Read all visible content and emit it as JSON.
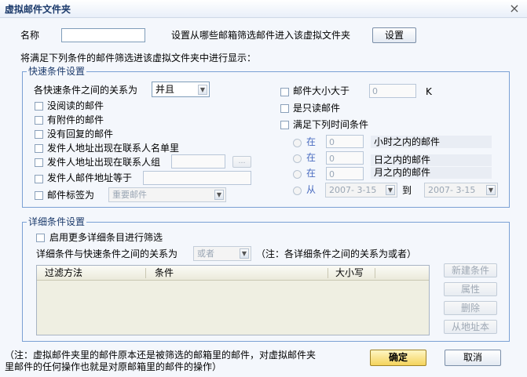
{
  "window": {
    "title": "虚拟邮件文件夹",
    "close_glyph": "×"
  },
  "name_row": {
    "label": "名称",
    "value": "",
    "hint": "设置从哪些邮箱筛选邮件进入该虚拟文件夹",
    "settings_button": "设置"
  },
  "intro": "将满足下列条件的邮件筛选进该虚拟文件夹中进行显示：",
  "quick": {
    "legend": "快速条件设置",
    "relation_label": "各快速条件之间的关系为",
    "relation_value": "并且",
    "left_items": [
      "没阅读的邮件",
      "有附件的邮件",
      "没有回复的邮件",
      "发件人地址出现在联系人名单里",
      "发件人地址出现在联系人组"
    ],
    "sender_label": "发件人邮件地址等于",
    "tag_label": "邮件标签为",
    "tag_value": "重要邮件",
    "size_label": "邮件大小大于",
    "size_value": "0",
    "size_unit": "K",
    "readonly_label": "是只读邮件",
    "time_label": "满足下列时间条件",
    "time_rows": [
      {
        "prefix": "在",
        "value": "0",
        "suffix": "小时之内的邮件"
      },
      {
        "prefix": "在",
        "value": "0",
        "suffix": "日之内的邮件"
      },
      {
        "prefix": "在",
        "value": "0",
        "suffix": "月之内的邮件"
      }
    ],
    "from_label": "从",
    "from_date": "2007- 3-15",
    "to_label": "到",
    "to_date": "2007- 3-15"
  },
  "detail": {
    "legend": "详细条件设置",
    "enable_label": "启用更多详细条目进行筛选",
    "relation_label": "详细条件与快速条件之间的关系为",
    "relation_value": "或者",
    "relation_note": "（注：各详细条件之间的关系为或者）",
    "columns": [
      "过滤方法",
      "条件",
      "大小写"
    ],
    "buttons": {
      "new": "新建条件",
      "props": "属性",
      "delete": "删除",
      "from_address": "从地址本"
    }
  },
  "footer": {
    "note_line1": "（注：虚拟邮件夹里的邮件原本还是被筛选的邮箱里的邮件，对虚拟邮件夹",
    "note_line2": "里邮件的任何操作也就是对原邮箱里的邮件的操作）",
    "ok": "确定",
    "cancel": "取消"
  }
}
